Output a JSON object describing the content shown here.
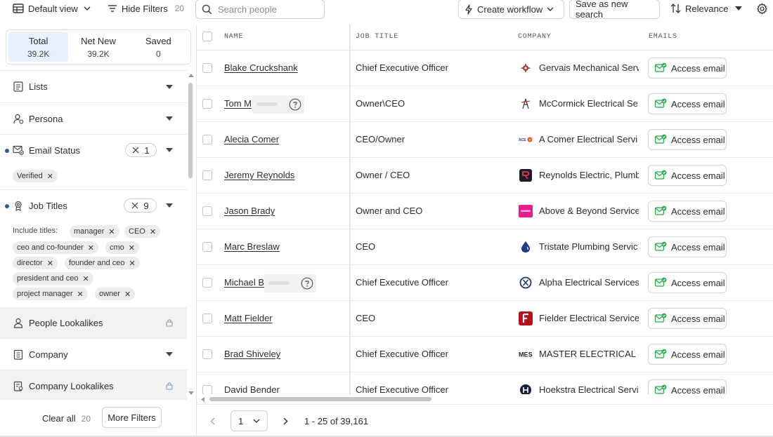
{
  "toolbar": {
    "view_label": "Default view",
    "hide_filters_label": "Hide Filters",
    "hide_filters_count": "20",
    "search_placeholder": "Search people",
    "create_workflow_label": "Create workflow",
    "save_search_label": "Save as new search",
    "sort_label": "Relevance"
  },
  "stats": {
    "total_label": "Total",
    "total_value": "39.2K",
    "new_label": "Net New",
    "new_value": "39.2K",
    "saved_label": "Saved",
    "saved_value": "0"
  },
  "filters": {
    "lists_label": "Lists",
    "persona_label": "Persona",
    "email_status_label": "Email Status",
    "email_status_count": "1",
    "email_status_chip": "Verified",
    "job_titles_label": "Job Titles",
    "job_titles_count": "9",
    "include_label": "Include titles:",
    "titles": [
      "manager",
      "CEO",
      "ceo and co-founder",
      "cmo",
      "director",
      "founder and ceo",
      "president and ceo",
      "project manager",
      "owner"
    ],
    "people_lookalikes_label": "People Lookalikes",
    "company_label": "Company",
    "company_lookalikes_label": "Company Lookalikes"
  },
  "footer": {
    "clear_all_label": "Clear all",
    "clear_all_count": "20",
    "more_filters_label": "More Filters"
  },
  "table": {
    "headers": {
      "name": "NAME",
      "job_title": "JOB TITLE",
      "company": "COMPANY",
      "emails": "EMAILS"
    },
    "email_button_label": "Access email",
    "rows": [
      {
        "name": "Blake Cruckshank",
        "title": "Chief Executive Officer",
        "company": "Gervais Mechanical Serv",
        "logo": "gear-logo"
      },
      {
        "name": "Tom M",
        "title": "Owner\\CEO",
        "company": "McCormick Electrical Se",
        "logo": "tower-logo"
      },
      {
        "name": "Alecia Comer",
        "title": "CEO/Owner",
        "company": "A Comer Electrical Servi",
        "logo": "acomer-logo"
      },
      {
        "name": "Jeremy Reynolds",
        "title": "Owner / CEO",
        "company": "Reynolds Electric, Plumb",
        "logo": "reynolds-logo"
      },
      {
        "name": "Jason Brady",
        "title": "Owner and CEO",
        "company": "Above & Beyond Service",
        "logo": "abovebeyond-logo"
      },
      {
        "name": "Marc Breslaw",
        "title": "CEO",
        "company": "Tristate Plumbing Servic",
        "logo": "droplet-logo"
      },
      {
        "name": "Michael B",
        "title": "Chief Executive Officer",
        "company": "Alpha Electrical Services",
        "logo": "alpha-logo"
      },
      {
        "name": "Matt Fielder",
        "title": "CEO",
        "company": "Fielder Electrical Service",
        "logo": "fielder-logo"
      },
      {
        "name": "Brad Shiveley",
        "title": "Chief Executive Officer",
        "company": "MASTER ELECTRICAL S",
        "logo": "master-logo"
      },
      {
        "name": "David Bender",
        "title": "Chief Executive Officer",
        "company": "Hoekstra Electrical Servi",
        "logo": "hoekstra-logo"
      }
    ]
  },
  "pagination": {
    "page": "1",
    "range_text": "1 - 25 of 39,161"
  },
  "colors": {
    "accent_blue": "#2e5b9a",
    "active_tab_bg": "#e7f0fb",
    "email_icon_green": "#2fa84f"
  }
}
